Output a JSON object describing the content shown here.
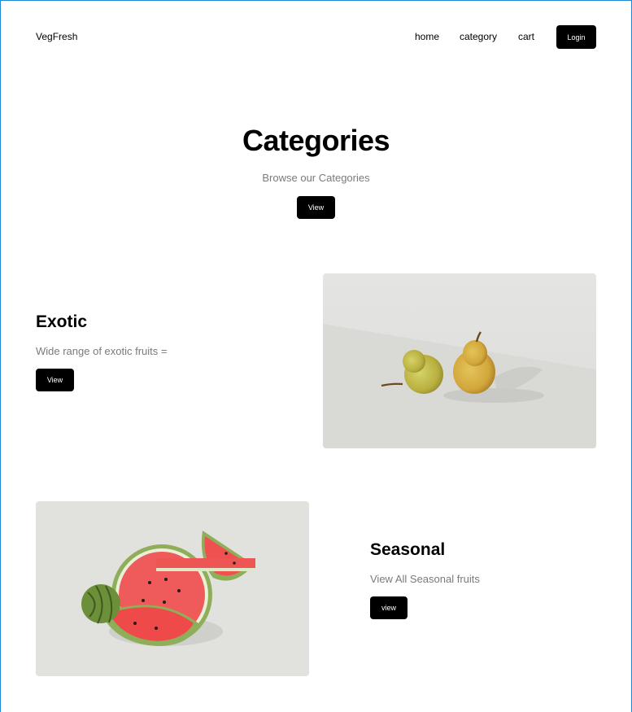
{
  "header": {
    "logo": "VegFresh",
    "nav": [
      "home",
      "category",
      "cart"
    ],
    "login_label": "Login"
  },
  "hero": {
    "title": "Categories",
    "subtitle": "Browse our Categories",
    "button_label": "View"
  },
  "sections": [
    {
      "title": "Exotic",
      "description": "Wide range of exotic fruits =",
      "button_label": "View"
    },
    {
      "title": "Seasonal",
      "description": "View All Seasonal fruits",
      "button_label": "view"
    }
  ],
  "colors": {
    "accent": "#000000",
    "muted_text": "#7a7a7a",
    "frame_border": "#1e8ad6"
  }
}
